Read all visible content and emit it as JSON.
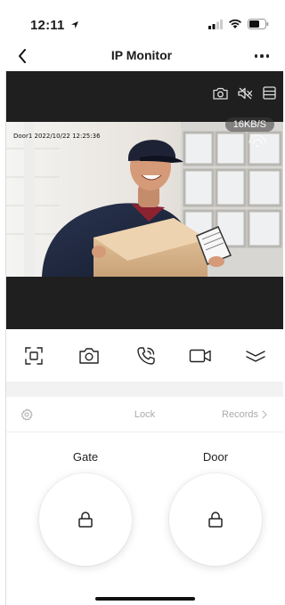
{
  "status_bar": {
    "time": "12:11",
    "icons": [
      "location-arrow-icon",
      "signal-icon",
      "wifi-icon",
      "battery-icon"
    ]
  },
  "nav": {
    "title": "IP Monitor",
    "back_icon": "chevron-left-icon",
    "more_icon": "more-dots-icon"
  },
  "video": {
    "tools": [
      "snapshot-icon",
      "mute-icon",
      "layout-icon"
    ],
    "bitrate": "16KB/S",
    "osd": "Door1 2022/10/22 12:25:36"
  },
  "controls": [
    "focus-frame-icon",
    "camera-icon",
    "phone-call-icon",
    "video-record-icon",
    "collapse-icon"
  ],
  "lock": {
    "label": "Lock",
    "records_label": "Records",
    "settings_icon": "gear-icon",
    "items": [
      {
        "name": "Gate",
        "icon": "lock-icon"
      },
      {
        "name": "Door",
        "icon": "lock-icon"
      }
    ]
  },
  "colors": {
    "video_bg": "#1f1f1f",
    "muted_text": "#aaaaaa",
    "strip_bg": "#f2f2f2"
  }
}
